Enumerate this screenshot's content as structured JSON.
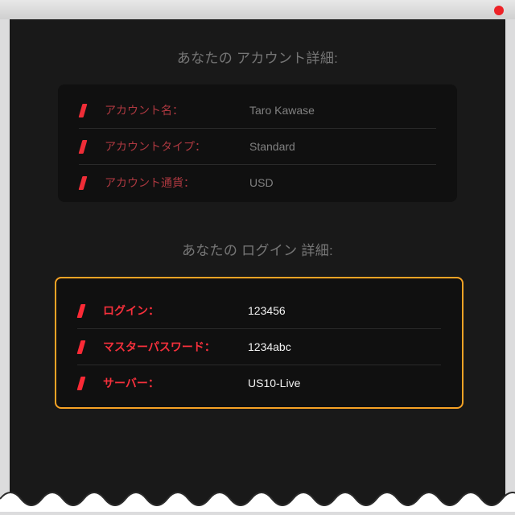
{
  "colors": {
    "accent_red": "#ef2d37",
    "highlight_border": "#f7a325",
    "background": "#191919"
  },
  "window": {
    "close_icon": "close-dot"
  },
  "sections": {
    "account": {
      "title": "あなたの アカウント詳細:",
      "rows": [
        {
          "icon": "edit-icon",
          "label": "アカウント名：",
          "value": "Taro Kawase"
        },
        {
          "icon": "edit-icon",
          "label": "アカウントタイプ：",
          "value": "Standard"
        },
        {
          "icon": "edit-icon",
          "label": "アカウント通貨：",
          "value": "USD"
        }
      ]
    },
    "login": {
      "title": "あなたの ログイン 詳細:",
      "highlighted": true,
      "rows": [
        {
          "icon": "edit-icon",
          "label": "ログイン：",
          "value": "123456"
        },
        {
          "icon": "edit-icon",
          "label": "マスターパスワード：",
          "value": "1234abc"
        },
        {
          "icon": "edit-icon",
          "label": "サーバー：",
          "value": "US10-Live"
        }
      ]
    }
  }
}
